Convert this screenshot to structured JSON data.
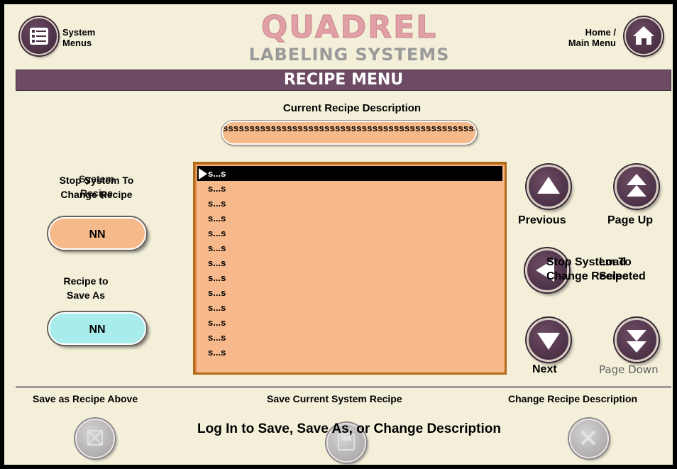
{
  "header": {
    "system_menus_label": "System\nMenus",
    "brand_title": "QUADREL",
    "brand_subtitle": "LABELING SYSTEMS",
    "home_label": "Home /\nMain Menu",
    "screen_title": "RECIPE MENU"
  },
  "description": {
    "label": "Current Recipe Description",
    "value": "sssssssssssssssssssssssssssssssssssssssssssssssssssssssssssssssssssssssssssssssssssssss"
  },
  "left": {
    "stop_label_a": "Stop System To\nChange Recipe",
    "stop_label_b": "System\nRecipe",
    "system_recipe_value": "NN",
    "save_as_label": "Recipe to\nSave As",
    "save_as_value": "NN"
  },
  "list": {
    "items": [
      "s...s",
      "s...s",
      "s...s",
      "s...s",
      "s...s",
      "s...s",
      "s...s",
      "s...s",
      "s...s",
      "s...s",
      "s...s",
      "s...s",
      "s...s"
    ],
    "selected_index": 0
  },
  "nav": {
    "previous": "Previous",
    "page_up": "Page Up",
    "next": "Next",
    "page_down": "Page Down",
    "load_overlap_a": "Stop System To\nChange Recipe",
    "load_overlap_b": "Load\nSelected"
  },
  "bottom": {
    "save_as_recipe_above": "Save as Recipe Above",
    "save_current_system_recipe": "Save Current System Recipe",
    "change_recipe_description": "Change Recipe Description",
    "login_message": "Log In to Save, Save As, or Change Description"
  },
  "colors": {
    "accent": "#6e4b65",
    "panel_bg": "#f3efd9",
    "list_bg": "#f7b98c",
    "system_recipe_pill": "#f5b98a",
    "save_as_pill": "#a8ecec"
  }
}
